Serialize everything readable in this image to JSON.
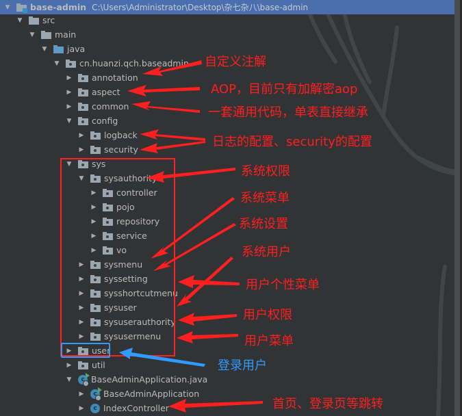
{
  "project": {
    "name": "base-admin",
    "path": "C:\\Users\\Administrator\\Desktop\\杂七杂八\\base-admin"
  },
  "tree": [
    {
      "label": "src",
      "expanded": true,
      "icon": "folder-icon"
    },
    {
      "label": "main",
      "expanded": true,
      "icon": "folder-icon"
    },
    {
      "label": "java",
      "expanded": true,
      "icon": "source-root-folder-icon"
    },
    {
      "label": "cn.huanzi.qch.baseadmin",
      "expanded": true,
      "icon": "package-icon"
    },
    {
      "label": "annotation",
      "expanded": false,
      "icon": "package-icon"
    },
    {
      "label": "aspect",
      "expanded": false,
      "icon": "package-icon"
    },
    {
      "label": "common",
      "expanded": false,
      "icon": "package-icon"
    },
    {
      "label": "config",
      "expanded": true,
      "icon": "package-icon"
    },
    {
      "label": "logback",
      "expanded": false,
      "icon": "package-icon"
    },
    {
      "label": "security",
      "expanded": false,
      "icon": "package-icon"
    },
    {
      "label": "sys",
      "expanded": true,
      "icon": "package-icon"
    },
    {
      "label": "sysauthority",
      "expanded": true,
      "icon": "package-icon"
    },
    {
      "label": "controller",
      "expanded": false,
      "icon": "package-icon"
    },
    {
      "label": "pojo",
      "expanded": false,
      "icon": "package-icon"
    },
    {
      "label": "repository",
      "expanded": false,
      "icon": "package-icon"
    },
    {
      "label": "service",
      "expanded": false,
      "icon": "package-icon"
    },
    {
      "label": "vo",
      "expanded": false,
      "icon": "package-icon"
    },
    {
      "label": "sysmenu",
      "expanded": false,
      "icon": "package-icon"
    },
    {
      "label": "syssetting",
      "expanded": false,
      "icon": "package-icon"
    },
    {
      "label": "sysshortcutmenu",
      "expanded": false,
      "icon": "package-icon"
    },
    {
      "label": "sysuser",
      "expanded": false,
      "icon": "package-icon"
    },
    {
      "label": "sysuserauthority",
      "expanded": false,
      "icon": "package-icon"
    },
    {
      "label": "sysusermenu",
      "expanded": false,
      "icon": "package-icon"
    },
    {
      "label": "user",
      "expanded": false,
      "icon": "package-icon"
    },
    {
      "label": "util",
      "expanded": false,
      "icon": "package-icon"
    },
    {
      "label": "BaseAdminApplication.java",
      "expanded": true,
      "icon": "spring-boot-class-icon"
    },
    {
      "label": "BaseAdminApplication",
      "expanded": false,
      "icon": "spring-boot-class-icon"
    },
    {
      "label": "IndexController",
      "expanded": false,
      "icon": "class-icon"
    }
  ],
  "annotations": {
    "annotation": "自定义注解",
    "aspect": "AOP，目前只有加解密aop",
    "common": "一套通用代码，单表直接继承",
    "config": "日志的配置、security的配置",
    "sysauthority": "系统权限",
    "sysmenu": "系统菜单",
    "syssetting": "系统设置",
    "sysuser": "系统用户",
    "sysshortcutmenu": "用户个性菜单",
    "sysuserauthority": "用户权限",
    "sysusermenu": "用户菜单",
    "user": "登录用户",
    "indexcontroller": "首页、登录页等跳转"
  },
  "colors": {
    "annotation_red": "#ff1f1f",
    "annotation_blue": "#2f9bff",
    "selection": "#4b6eaf",
    "background": "#313335"
  }
}
